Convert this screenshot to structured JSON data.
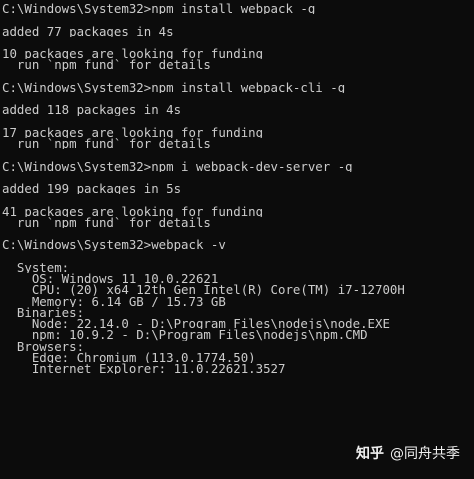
{
  "terminal": {
    "lines": [
      "C:\\Windows\\System32>npm install webpack -g",
      "",
      "added 77 packages in 4s",
      "",
      "10 packages are looking for funding",
      "  run `npm fund` for details",
      "",
      "C:\\Windows\\System32>npm install webpack-cli -g",
      "",
      "added 118 packages in 4s",
      "",
      "17 packages are looking for funding",
      "  run `npm fund` for details",
      "",
      "C:\\Windows\\System32>npm i webpack-dev-server -g",
      "",
      "added 199 packages in 5s",
      "",
      "41 packages are looking for funding",
      "  run `npm fund` for details",
      "",
      "C:\\Windows\\System32>webpack -v",
      "",
      "  System:",
      "    OS: Windows 11 10.0.22621",
      "    CPU: (20) x64 12th Gen Intel(R) Core(TM) i7-12700H",
      "    Memory: 6.14 GB / 15.73 GB",
      "  Binaries:",
      "    Node: 22.14.0 - D:\\Program Files\\nodejs\\node.EXE",
      "    npm: 10.9.2 - D:\\Program Files\\nodejs\\npm.CMD",
      "  Browsers:",
      "    Edge: Chromium (113.0.1774.50)",
      "    Internet Explorer: 11.0.22621.3527"
    ]
  },
  "watermark": {
    "brand": "知乎",
    "author": "@同舟共季"
  }
}
